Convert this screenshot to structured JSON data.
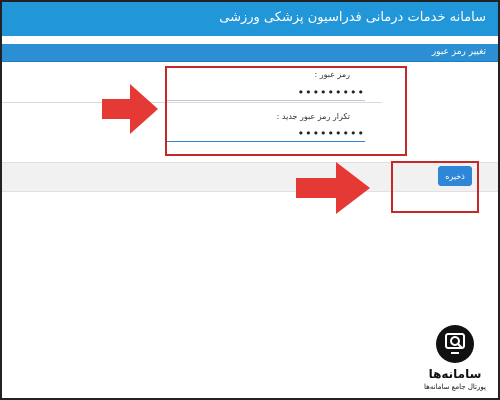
{
  "app": {
    "title": "سامانه خدمات درمانی فدراسیون پزشکی ورزشی"
  },
  "panel": {
    "heading": "تغییر رمز عبور"
  },
  "form": {
    "password_label": "رمز عبور :",
    "password_value": "•••••••••",
    "confirm_label": "تکرار رمز عبور جدید :",
    "confirm_value": "•••••••••"
  },
  "actions": {
    "save_label": "ذخیره"
  },
  "branding": {
    "name": "سامانه‌ها",
    "tagline": "پورتال جامع سامانه‌ها"
  },
  "colors": {
    "header": "#2196d9",
    "accent": "#2e86d6",
    "highlight": "#c62828",
    "arrow": "#e53935"
  }
}
